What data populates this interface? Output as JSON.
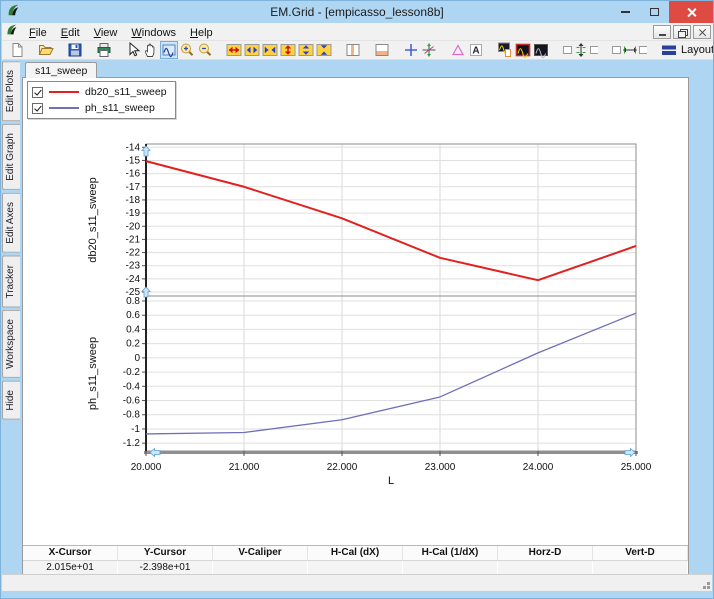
{
  "window": {
    "title": "EM.Grid - [empicasso_lesson8b]"
  },
  "colors": {
    "frame_blue": "#aed6f2",
    "close_red": "#dd4b42",
    "series_red": "#e32020",
    "series_blue": "#7070b8",
    "gridline": "#dadada",
    "toolbar_selected": "#cfe4f8"
  },
  "menu": {
    "items": [
      "File",
      "Edit",
      "View",
      "Windows",
      "Help"
    ]
  },
  "toolbar": {
    "layout_label": "Layout",
    "icons": [
      "new-file-icon",
      "open-file-icon",
      "save-icon",
      "print-icon",
      "pointer-icon",
      "pan-hand-icon",
      "zoom-window-icon",
      "zoom-in-icon",
      "zoom-out-icon",
      "fit-x-icon",
      "expand-x-icon",
      "compress-x-icon",
      "fit-y-icon",
      "expand-y-icon",
      "compress-y-icon",
      "split-columns-icon",
      "split-rows-icon",
      "cursor-cross-icon",
      "tracker-icon",
      "caliper-icon",
      "text-label-icon",
      "graph-marker-icon",
      "graph-red-icon",
      "graph-plain-icon",
      "align-vertical-icon",
      "align-horizontal-icon",
      "layout-icon"
    ],
    "selected_icon": "zoom-window-icon"
  },
  "tabs": {
    "active": "s11_sweep"
  },
  "sidebar": {
    "items": [
      "Edit Plots",
      "Edit Graph",
      "Edit Axes",
      "Tracker",
      "Workspace",
      "Hide"
    ]
  },
  "legend": {
    "entries": [
      {
        "label": "db20_s11_sweep",
        "color": "#e32020",
        "checked": true
      },
      {
        "label": "ph_s11_sweep",
        "color": "#7070b8",
        "checked": true
      }
    ]
  },
  "chart_data": {
    "type": "line",
    "x": [
      20,
      21,
      22,
      23,
      24,
      25
    ],
    "xlim": [
      20,
      25
    ],
    "x_tick_labels": [
      "20.000",
      "21.000",
      "22.000",
      "23.000",
      "24.000",
      "25.000"
    ],
    "xlabel": "L",
    "grid": true,
    "legend_position": "top-left",
    "panels": [
      {
        "ylabel": "db20_s11_sweep",
        "ylim": [
          -25.3,
          -13.75
        ],
        "yticks": [
          -14,
          -15,
          -16,
          -17,
          -18,
          -19,
          -20,
          -21,
          -22,
          -23,
          -24,
          -25
        ],
        "series": [
          {
            "name": "db20_s11_sweep",
            "color": "#e32020",
            "width": 2,
            "values": [
              -15.05,
              -17.0,
              -19.4,
              -22.4,
              -24.1,
              -21.5
            ]
          }
        ]
      },
      {
        "ylabel": "ph_s11_sweep",
        "ylim": [
          -1.31,
          0.87
        ],
        "yticks": [
          0.8,
          0.6,
          0.4,
          0.2,
          0,
          -0.2,
          -0.4,
          -0.6,
          -0.8,
          -1,
          -1.2
        ],
        "series": [
          {
            "name": "ph_s11_sweep",
            "color": "#7070b8",
            "width": 1.3,
            "values": [
              -1.07,
              -1.05,
              -0.87,
              -0.55,
              0.07,
              0.63
            ]
          }
        ]
      }
    ]
  },
  "cursor_table": {
    "headers": [
      "X-Cursor",
      "Y-Cursor",
      "V-Caliper",
      "H-Cal (dX)",
      "H-Cal (1/dX)",
      "Horz-D",
      "Vert-D"
    ],
    "values": [
      "2.015e+01",
      "-2.398e+01",
      "",
      "",
      "",
      "",
      ""
    ]
  },
  "status": {
    "text": ""
  }
}
